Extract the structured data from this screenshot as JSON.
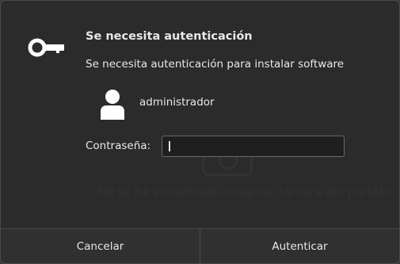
{
  "dialog": {
    "title": "Se necesita autenticación",
    "message": "Se necesita autenticación para instalar software",
    "username": "administrador",
    "password_label": "Contraseña:",
    "password_value": "",
    "background_text": "No se ha encontrado ninguna cámara del portátil"
  },
  "buttons": {
    "cancel": "Cancelar",
    "authenticate": "Autenticar"
  },
  "icons": {
    "key": "key-icon",
    "user": "user-icon"
  },
  "colors": {
    "background": "#2b2b2b",
    "text": "#e8e8e8",
    "border": "#4a4a4a"
  }
}
